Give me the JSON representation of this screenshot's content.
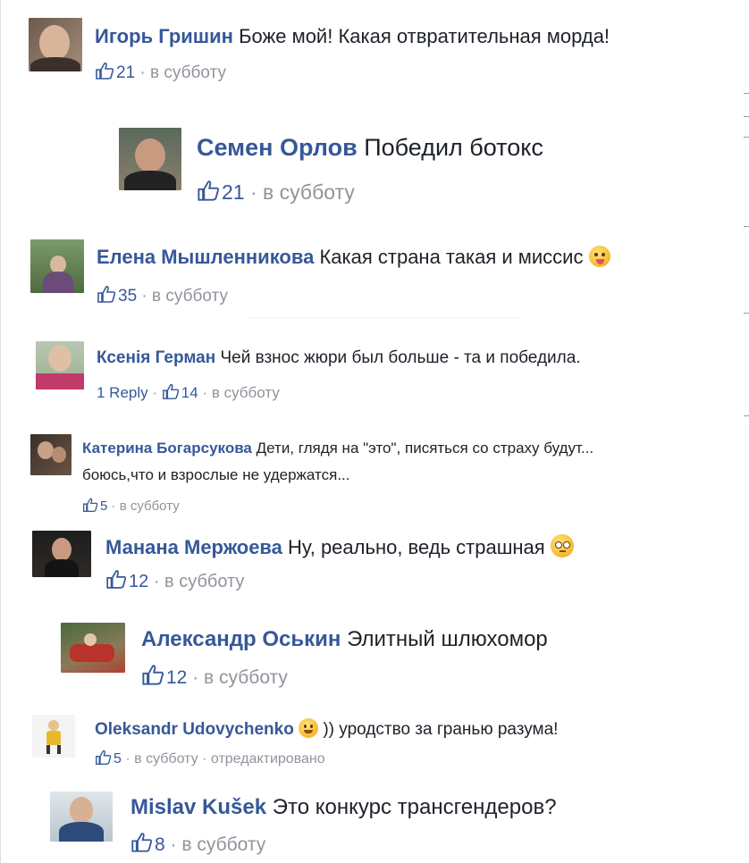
{
  "comments": [
    {
      "author": "Игорь Гришин",
      "text": "Боже мой! Какая отвратительная морда!",
      "likes": "21",
      "time": "в субботу"
    },
    {
      "author": "Семен Орлов",
      "text": "Победил ботокс",
      "likes": "21",
      "time": "в субботу"
    },
    {
      "author": "Елена Мышленникова",
      "text": "Какая страна такая и миссис",
      "likes": "35",
      "time": "в субботу"
    },
    {
      "author": "Ксенія Герман",
      "text": "Чей взнос жюри был больше - та и победила.",
      "reply": "1 Reply",
      "likes": "14",
      "time": "в субботу"
    },
    {
      "author": "Катерина Богарсукова",
      "text": "Дети, глядя на \"это\", писяться со страху будут...",
      "text2": "боюсь,что и взрослые не удержатся...",
      "likes": "5",
      "time": "в субботу"
    },
    {
      "author": "Манана Мержоева",
      "text": "Ну, реально, ведь страшная",
      "likes": "12",
      "time": "в субботу"
    },
    {
      "author": "Александр Оськин",
      "text": "Элитный шлюхомор",
      "likes": "12",
      "time": "в субботу"
    },
    {
      "author": "Oleksandr Udovychenko",
      "text": ")) уродство за гранью разума!",
      "likes": "5",
      "time": "в субботу",
      "edited": "отредактировано"
    },
    {
      "author": "Mislav Kušek",
      "text": "Это конкурс трансгендеров?",
      "likes": "8",
      "time": "в субботу"
    }
  ],
  "separator": "·",
  "icons": {
    "like": "thumbs-up-icon",
    "emoji": "smiley-emoji-icon"
  },
  "colors": {
    "author": "#365899",
    "text": "#1d2129",
    "meta": "#90949c"
  }
}
